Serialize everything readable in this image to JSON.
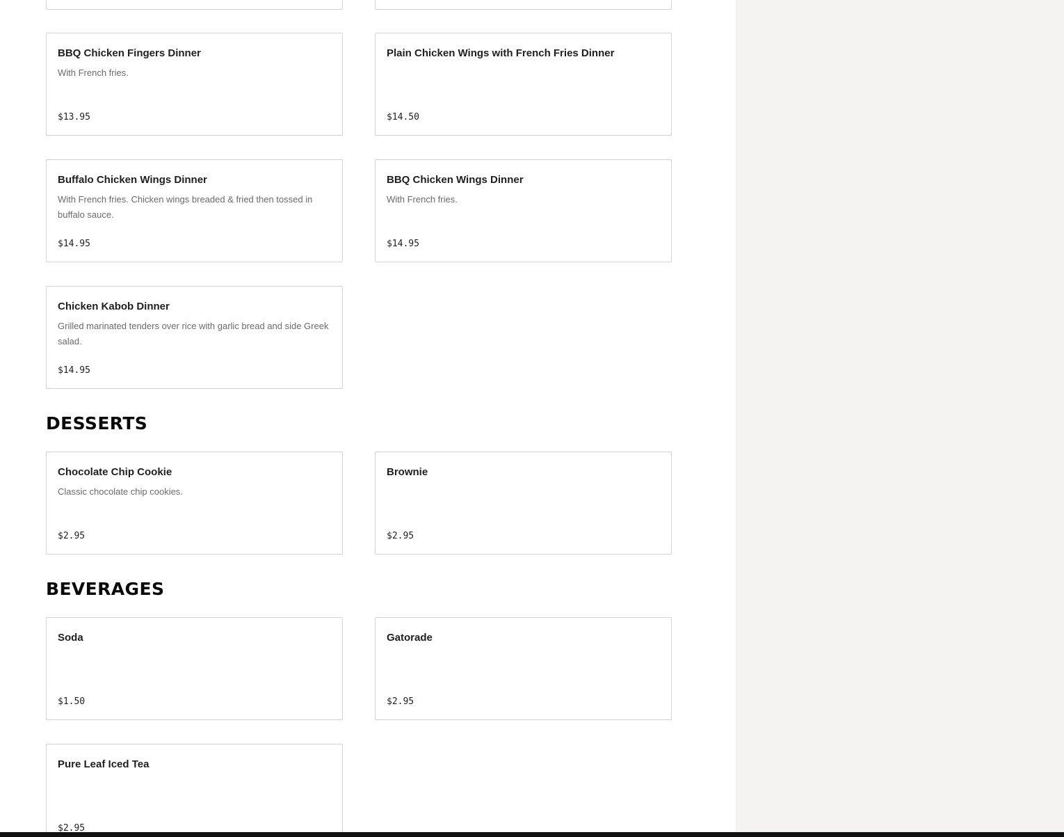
{
  "sections": {
    "dinners": {
      "items": [
        {
          "name": "BBQ Chicken Fingers Dinner",
          "description": "With French fries.",
          "price": "$13.95"
        },
        {
          "name": "Plain Chicken Wings with French Fries Dinner",
          "description": "",
          "price": "$14.50"
        },
        {
          "name": "Buffalo Chicken Wings Dinner",
          "description": "With French fries. Chicken wings breaded & fried then tossed in buffalo sauce.",
          "price": "$14.95"
        },
        {
          "name": "BBQ Chicken Wings Dinner",
          "description": "With French fries.",
          "price": "$14.95"
        },
        {
          "name": "Chicken Kabob Dinner",
          "description": "Grilled marinated tenders over rice with garlic bread and side Greek salad.",
          "price": "$14.95"
        }
      ]
    },
    "desserts": {
      "title": "DESSERTS",
      "items": [
        {
          "name": "Chocolate Chip Cookie",
          "description": "Classic chocolate chip cookies.",
          "price": "$2.95"
        },
        {
          "name": "Brownie",
          "description": "",
          "price": "$2.95"
        }
      ]
    },
    "beverages": {
      "title": "BEVERAGES",
      "items": [
        {
          "name": "Soda",
          "description": "",
          "price": "$1.50"
        },
        {
          "name": "Gatorade",
          "description": "",
          "price": "$2.95"
        },
        {
          "name": "Pure Leaf Iced Tea",
          "description": "",
          "price": "$2.95"
        }
      ]
    }
  },
  "colors": {
    "side_panel_bg": "#f4f3f1",
    "card_border": "#d4d4d4",
    "description_text": "#6b6b6b"
  }
}
